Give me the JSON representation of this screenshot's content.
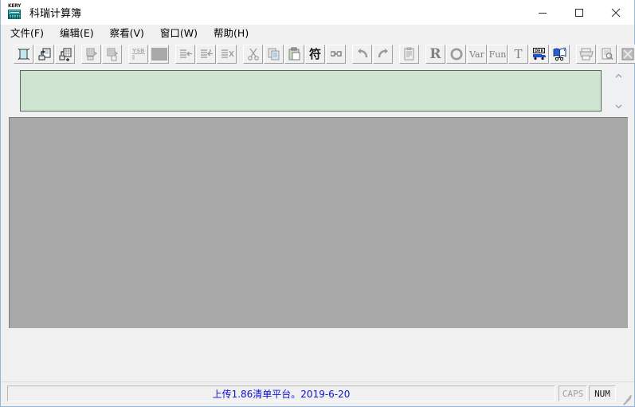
{
  "window": {
    "title": "科瑞计算簿",
    "icon_name": "calculator-app-icon",
    "icon_label": "KERY",
    "controls": {
      "minimize": "minimize",
      "maximize": "maximize",
      "close": "close"
    }
  },
  "menubar": {
    "items": [
      {
        "label": "文件(F)",
        "name": "menu-file"
      },
      {
        "label": "编辑(E)",
        "name": "menu-edit"
      },
      {
        "label": "察看(V)",
        "name": "menu-view"
      },
      {
        "label": "窗口(W)",
        "name": "menu-window"
      },
      {
        "label": "帮助(H)",
        "name": "menu-help"
      }
    ]
  },
  "toolbar": {
    "buttons": [
      {
        "name": "new-document-button",
        "icon": "new-page-icon",
        "enabled": true
      },
      {
        "name": "open-document-button",
        "icon": "open-folder-icon",
        "enabled": true
      },
      {
        "name": "add-sheet-button",
        "icon": "sheet-plus-icon",
        "enabled": true
      },
      {
        "name": "import-sheet-button",
        "icon": "sheet-import-icon",
        "enabled": false
      },
      {
        "name": "export-sheet-button",
        "icon": "sheet-export-icon",
        "enabled": false
      },
      {
        "name": "ysb-button",
        "icon": "ysb-label-icon",
        "enabled": false,
        "label": "YSB"
      },
      {
        "name": "block-button",
        "icon": "filled-block-icon",
        "enabled": false
      },
      {
        "name": "indent-left-button",
        "icon": "indent-left-icon",
        "enabled": false
      },
      {
        "name": "indent-split-button",
        "icon": "indent-split-icon",
        "enabled": false
      },
      {
        "name": "indent-right-button",
        "icon": "indent-right-icon",
        "enabled": false
      },
      {
        "name": "cut-button",
        "icon": "scissors-icon",
        "enabled": false
      },
      {
        "name": "copy-button",
        "icon": "copy-icon",
        "enabled": false
      },
      {
        "name": "paste-button",
        "icon": "clipboard-icon",
        "enabled": false
      },
      {
        "name": "symbol-button",
        "icon": "symbol-fu-icon",
        "enabled": true,
        "label": "符"
      },
      {
        "name": "find-button",
        "icon": "binoculars-icon",
        "enabled": false
      },
      {
        "name": "undo-button",
        "icon": "undo-arrow-icon",
        "enabled": false
      },
      {
        "name": "redo-button",
        "icon": "redo-arrow-icon",
        "enabled": false
      },
      {
        "name": "properties-button",
        "icon": "clipboard-list-icon",
        "enabled": false
      },
      {
        "name": "r-function-button",
        "icon": "letter-r-icon",
        "enabled": false,
        "label": "R"
      },
      {
        "name": "circle-button",
        "icon": "ring-icon",
        "enabled": false
      },
      {
        "name": "variable-button",
        "icon": "var-label-icon",
        "enabled": false,
        "label": "Var"
      },
      {
        "name": "function-button",
        "icon": "fun-label-icon",
        "enabled": false,
        "label": "Fun"
      },
      {
        "name": "text-button",
        "icon": "letter-t-icon",
        "enabled": false,
        "label": "T"
      },
      {
        "name": "dek-truck-button",
        "icon": "dek-truck-icon",
        "enabled": true,
        "label": "DEK"
      },
      {
        "name": "book-help-button",
        "icon": "open-book-icon",
        "enabled": true
      },
      {
        "name": "print-button",
        "icon": "printer-icon",
        "enabled": false
      },
      {
        "name": "print-preview-button",
        "icon": "print-preview-icon",
        "enabled": false
      },
      {
        "name": "export-excel-button",
        "icon": "excel-export-icon",
        "enabled": false
      },
      {
        "name": "help-button",
        "icon": "question-mark-icon",
        "enabled": true
      }
    ]
  },
  "document": {
    "child_window_name": "document-child-window",
    "content": "",
    "background_color": "#cfe4d0"
  },
  "mdi": {
    "background_color": "#a8a8a8"
  },
  "statusbar": {
    "message": "上传1.86清单平台。2019-6-20",
    "message_color": "#1010d0",
    "caps": "CAPS",
    "num": "NUM"
  }
}
